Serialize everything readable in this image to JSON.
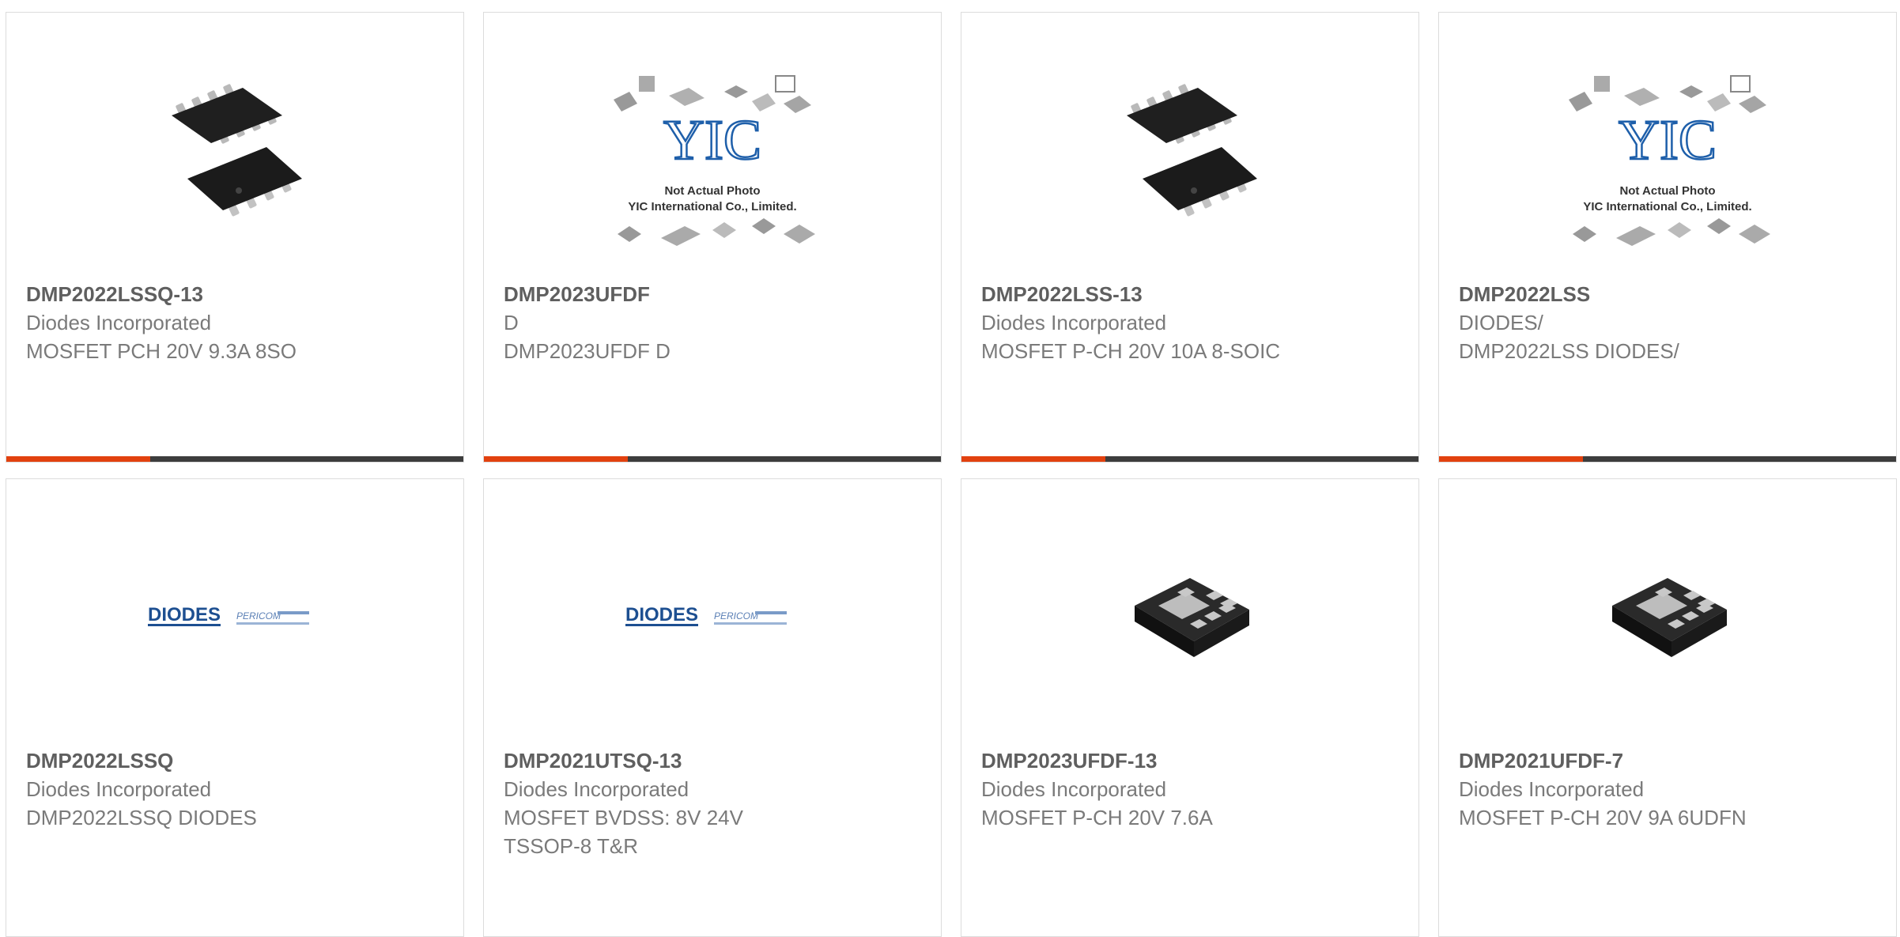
{
  "accent_color": "#e2410f",
  "bar_color": "#3d3d3d",
  "products": [
    {
      "part_number": "DMP2022LSSQ-13",
      "manufacturer": "Diodes Incorporated",
      "description": "MOSFET PCH 20V 9.3A 8SO",
      "image": "soic-8-chip-icon"
    },
    {
      "part_number": "DMP2023UFDF",
      "manufacturer": "D",
      "description": "DMP2023UFDF D",
      "image": "yic-placeholder-icon",
      "placeholder_line1": "Not Actual Photo",
      "placeholder_line2": "YIC International Co., Limited."
    },
    {
      "part_number": "DMP2022LSS-13",
      "manufacturer": "Diodes Incorporated",
      "description": "MOSFET P-CH 20V 10A 8-SOIC",
      "image": "soic-8-chip-icon"
    },
    {
      "part_number": "DMP2022LSS",
      "manufacturer": "DIODES/",
      "description": "DMP2022LSS DIODES/",
      "image": "yic-placeholder-icon",
      "placeholder_line1": "Not Actual Photo",
      "placeholder_line2": "YIC International Co., Limited."
    },
    {
      "part_number": "DMP2022LSSQ",
      "manufacturer": "Diodes Incorporated",
      "description": "DMP2022LSSQ DIODES",
      "image": "diodes-pericom-logo",
      "logo_text": "DIODES",
      "logo_sub": "PERICOM"
    },
    {
      "part_number": "DMP2021UTSQ-13",
      "manufacturer": "Diodes Incorporated",
      "description": "MOSFET BVDSS: 8V 24V TSSOP-8 T&R",
      "image": "diodes-pericom-logo",
      "logo_text": "DIODES",
      "logo_sub": "PERICOM"
    },
    {
      "part_number": "DMP2023UFDF-13",
      "manufacturer": "Diodes Incorporated",
      "description": "MOSFET P-CH 20V 7.6A",
      "image": "udfn-chip-icon"
    },
    {
      "part_number": "DMP2021UFDF-7",
      "manufacturer": "Diodes Incorporated",
      "description": "MOSFET P-CH 20V 9A 6UDFN",
      "image": "udfn-chip-icon"
    }
  ]
}
